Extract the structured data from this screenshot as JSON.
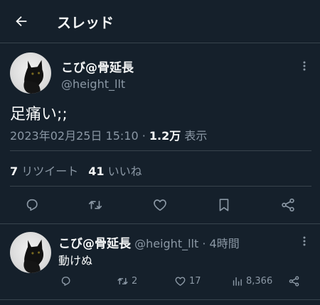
{
  "header": {
    "title": "スレッド"
  },
  "tweet": {
    "display_name": "こび@骨延長",
    "handle": "@height_llt",
    "text": "足痛い;;",
    "timestamp": "2023年02月25日 15:10",
    "separator": "·",
    "views_count": "1.2万",
    "views_label": "表示",
    "retweets_count": "7",
    "retweets_label": "リツイート",
    "likes_count": "41",
    "likes_label": "いいね"
  },
  "reply": {
    "display_name": "こび@骨延長",
    "handle": "@height_llt",
    "time": "· 4時間",
    "text": "動けぬ",
    "retweets": "2",
    "likes": "17",
    "views": "8,366"
  },
  "colors": {
    "background": "#15202b",
    "text": "#f7f9f9",
    "secondary": "#8b98a5",
    "divider": "#38444d"
  },
  "icons": {
    "back": "arrow-left-icon",
    "more": "more-vertical-icon",
    "reply": "reply-icon",
    "retweet": "retweet-icon",
    "like": "heart-icon",
    "bookmark": "bookmark-icon",
    "share": "share-icon",
    "views": "views-icon"
  }
}
